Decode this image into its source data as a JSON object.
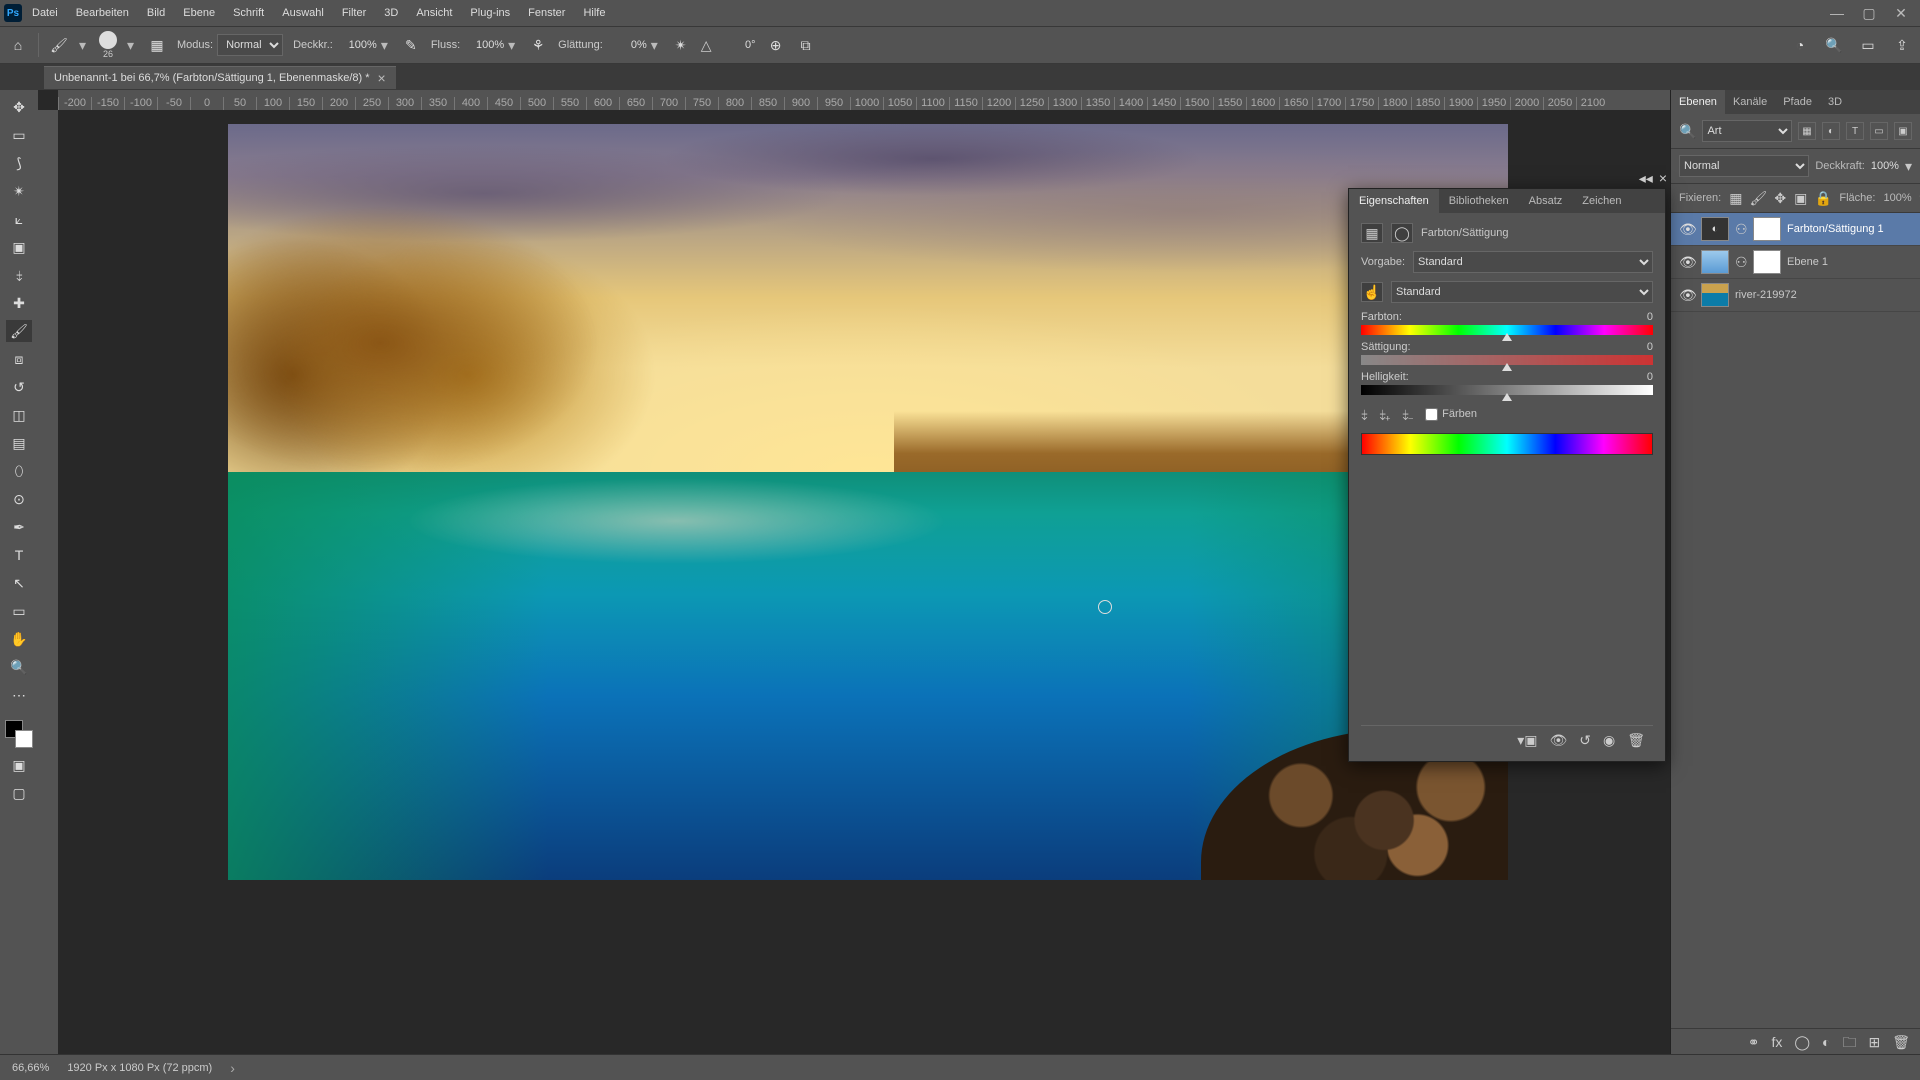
{
  "menu": [
    "Datei",
    "Bearbeiten",
    "Bild",
    "Ebene",
    "Schrift",
    "Auswahl",
    "Filter",
    "3D",
    "Ansicht",
    "Plug-ins",
    "Fenster",
    "Hilfe"
  ],
  "optionsbar": {
    "brush_size": "26",
    "mode_label": "Modus:",
    "mode_value": "Normal",
    "opacity_label": "Deckkr.:",
    "opacity_value": "100%",
    "flow_label": "Fluss:",
    "flow_value": "100%",
    "smoothing_label": "Glättung:",
    "smoothing_value": "0%",
    "angle_glyph": "△",
    "angle_value": "0°"
  },
  "document": {
    "tab_title": "Unbenannt-1 bei 66,7% (Farbton/Sättigung 1, Ebenenmaske/8) *"
  },
  "ruler_marks": [
    "-200",
    "-150",
    "-100",
    "-50",
    "0",
    "50",
    "100",
    "150",
    "200",
    "250",
    "300",
    "350",
    "400",
    "450",
    "500",
    "550",
    "600",
    "650",
    "700",
    "750",
    "800",
    "850",
    "900",
    "950",
    "1000",
    "1050",
    "1100",
    "1150",
    "1200",
    "1250",
    "1300",
    "1350",
    "1400",
    "1450",
    "1500",
    "1550",
    "1600",
    "1650",
    "1700",
    "1750",
    "1800",
    "1850",
    "1900",
    "1950",
    "2000",
    "2050",
    "2100"
  ],
  "properties": {
    "tabs": [
      "Eigenschaften",
      "Bibliotheken",
      "Absatz",
      "Zeichen"
    ],
    "adj_label": "Farbton/Sättigung",
    "preset_label": "Vorgabe:",
    "preset_value": "Standard",
    "channel_value": "Standard",
    "hue_label": "Farbton:",
    "hue_value": "0",
    "sat_label": "Sättigung:",
    "sat_value": "0",
    "light_label": "Helligkeit:",
    "light_value": "0",
    "colorize_label": "Färben"
  },
  "layerspanel": {
    "tabs": [
      "Ebenen",
      "Kanäle",
      "Pfade",
      "3D"
    ],
    "search_kind": "Art",
    "blend_value": "Normal",
    "opacity_label": "Deckkraft:",
    "opacity_value": "100%",
    "lock_label": "Fixieren:",
    "fill_label": "Fläche:",
    "fill_value": "100%",
    "layers": [
      {
        "name": "Farbton/Sättigung 1",
        "kind": "adj",
        "selected": true
      },
      {
        "name": "Ebene 1",
        "kind": "sky",
        "selected": false
      },
      {
        "name": "river-219972",
        "kind": "img",
        "selected": false
      }
    ]
  },
  "status": {
    "zoom": "66,66%",
    "docinfo": "1920 Px x 1080 Px (72 ppcm)"
  }
}
